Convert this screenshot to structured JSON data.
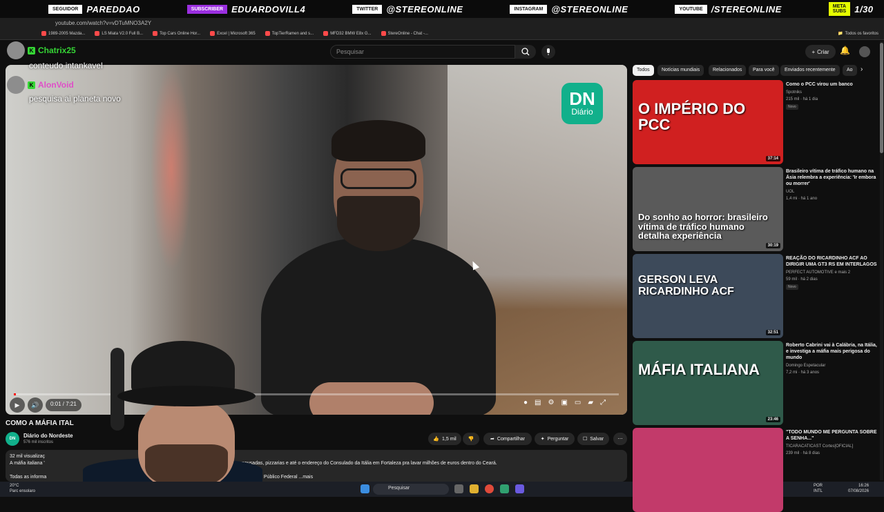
{
  "stream_bar": {
    "items": [
      {
        "tag": "SEGUIDOR",
        "value": "PAREDDAO"
      },
      {
        "tag": "SUBSCRIBER",
        "value": "EDUARDOVILL4"
      },
      {
        "tag": "TWITTER",
        "value": "@STEREONLINE"
      },
      {
        "tag": "INSTAGRAM",
        "value": "@STEREONLINE"
      },
      {
        "tag": "YOUTUBE",
        "value": "/STEREONLINE"
      },
      {
        "tag": "META SUBS",
        "value": "1/30"
      }
    ]
  },
  "browser": {
    "url": "youtube.com/watch?v=vDTuMNO3A2Y",
    "bookmarks": [
      "1989-2005 Mazda...",
      "LS Miata V2.0 Full B...",
      "Top Cars Online Hor...",
      "Excel | Microsoft 365",
      "TopTierRamen and s...",
      "MFD32 BMW E8x G...",
      "StereOnline - Chat -..."
    ],
    "favorites_label": "Todos os favoritos"
  },
  "header": {
    "search_placeholder": "Pesquisar",
    "create_label": "Criar"
  },
  "chat": [
    {
      "user": "Chatrix25",
      "message": "conteudo intankavel",
      "user_color": "#35d635"
    },
    {
      "user": "AlonVoid",
      "message": "pesquisa ai planeta novo",
      "user_color": "#e04ec8"
    }
  ],
  "video": {
    "logo_top": "DN",
    "logo_bottom": "Diário",
    "time": "0:01 / 7:21",
    "progress_pct": 0.3,
    "title": "COMO A MÁFIA ITAL",
    "channel": "Diário do Nordeste",
    "subs": "576 mil inscritos",
    "likes": "1,5 mil",
    "share": "Compartilhar",
    "ask": "Perguntar",
    "save": "Salvar",
    "desc_line1": "32 mil visualizaç",
    "desc_line2": "A máfia italiana '",
    "desc_mid": "pousadas, pizzarias e até o endereço do Consulado da Itália em Fortaleza pra lavar milhões de euros dentro do Ceará.",
    "desc_line3": "Todas as informa",
    "desc_more": "Ministério Público Federal  ...mais"
  },
  "chips": [
    "Todos",
    "Notícias mundiais",
    "Relacionados",
    "Para você",
    "Enviados recentemente",
    "Ao"
  ],
  "recommendations": [
    {
      "title": "Como o PCC virou um banco",
      "channel": "Spotniks",
      "meta": "215 mil · há 1 dia",
      "badge": "Novo",
      "duration": "37:14",
      "thumb_text": "O IMPÉRIO DO PCC",
      "thumb_color": "#d02020"
    },
    {
      "title": "Brasileiro vítima de tráfico humano na Ásia relembra a experiência: 'Ir embora ou morrer'",
      "channel": "UOL",
      "meta": "1,4 mi · há 1 ano",
      "badge": "",
      "duration": "30:19",
      "thumb_text": "Do sonho ao horror: brasileiro vítima de tráfico humano detalha experiência",
      "thumb_color": "#5a5a5a"
    },
    {
      "title": "REAÇÃO DO RICARDINHO ACF AO DIRIGIR UMA GT3 RS EM INTERLAGOS",
      "channel": "PERFECT AUTOMOTIVE e mais 2",
      "meta": "59 mil · há 2 dias",
      "badge": "Novo",
      "duration": "32:51",
      "thumb_text": "GERSON LEVA RICARDINHO ACF",
      "thumb_color": "#3d4a5a"
    },
    {
      "title": "Roberto Cabrini vai à Calábria, na Itália, e investiga a máfia mais perigosa do mundo",
      "channel": "Domingo Espetacular",
      "meta": "7,2 mi · há 3 anos",
      "badge": "",
      "duration": "23:46",
      "thumb_text": "MÁFIA ITALIANA",
      "thumb_color": "#2f5a4a"
    },
    {
      "title": "\"TODO MUNDO ME PERGUNTA SOBRE A SENHA...\"",
      "channel": "TICARACATICAST Cortes[OFICIAL]",
      "meta": "239 mil · há 8 dias",
      "badge": "",
      "duration": "",
      "thumb_text": "",
      "thumb_color": "#c23a6a"
    }
  ],
  "taskbar": {
    "temp": "20°C",
    "weather": "Parc ensolaro",
    "search": "Pesquisar",
    "lang1": "POR",
    "lang2": "INTL",
    "time": "16:26",
    "date": "07/08/2026"
  }
}
